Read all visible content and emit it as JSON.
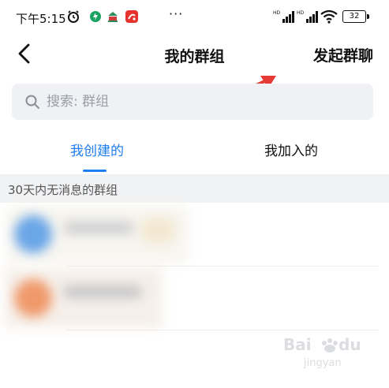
{
  "status_bar": {
    "time": "下午5:15",
    "more": "···",
    "battery": "32"
  },
  "header": {
    "title": "我的群组",
    "action": "发起群聊"
  },
  "search": {
    "placeholder": "搜索: 群组"
  },
  "tabs": [
    {
      "label": "我创建的",
      "active": true
    },
    {
      "label": "我加入的",
      "active": false
    }
  ],
  "section": {
    "title": "30天内无消息的群组"
  },
  "colors": {
    "accent": "#1e7df0",
    "annotation_arrow": "#e53935"
  },
  "watermark": {
    "text": "Bai du 经验"
  }
}
